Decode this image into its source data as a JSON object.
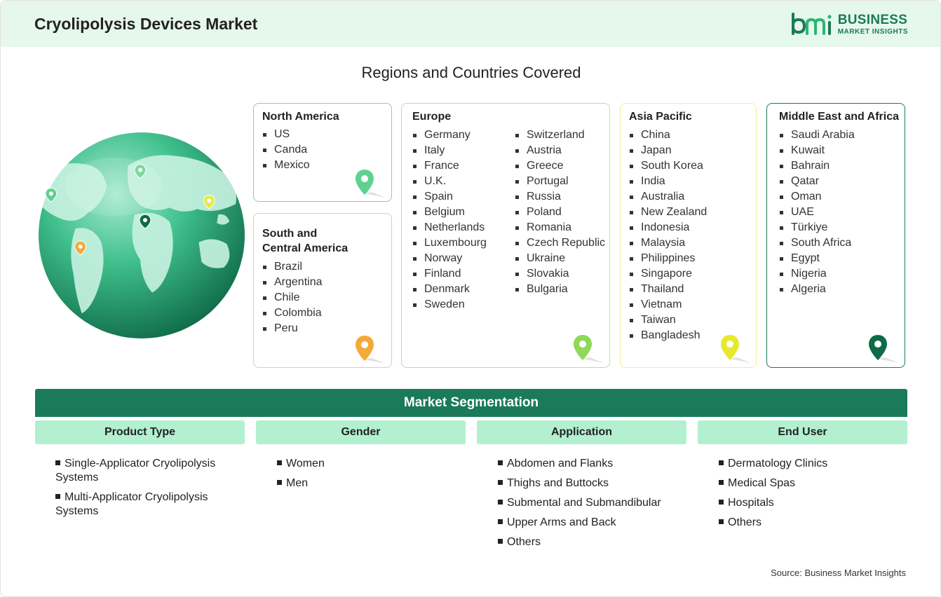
{
  "header": {
    "title": "Cryolipolysis Devices Market",
    "logo_line1": "BUSINESS",
    "logo_line2": "MARKET INSIGHTS",
    "brand_color": "#1a7a5a",
    "background": "#e6f7ec"
  },
  "regions": {
    "title": "Regions and Countries Covered",
    "north_america": {
      "title": "North America",
      "color": "#7ed8a0",
      "items": [
        "US",
        "Canda",
        "Mexico"
      ]
    },
    "south_central_america": {
      "title_line1": "South and",
      "title_line2": "Central America",
      "color": "#f5c98a",
      "items": [
        "Brazil",
        "Argentina",
        "Chile",
        "Colombia",
        "Peru"
      ]
    },
    "europe": {
      "title": "Europe",
      "color": "#b5e3a0",
      "col1": [
        "Germany",
        "Italy",
        "France",
        "U.K.",
        "Spain",
        "Belgium",
        "Netherlands",
        "Luxembourg",
        "Norway",
        "Finland",
        "Denmark",
        "Sweden"
      ],
      "col2": [
        "Switzerland",
        "Austria",
        "Greece",
        "Portugal",
        "Russia",
        "Poland",
        "Romania",
        "Czech Republic",
        "Ukraine",
        "Slovakia",
        "Bulgaria"
      ]
    },
    "asia_pacific": {
      "title": "Asia Pacific",
      "color": "#eef08a",
      "items": [
        "China",
        "Japan",
        "South Korea",
        "India",
        "Australia",
        "New Zealand",
        "Indonesia",
        "Malaysia",
        "Philippines",
        "Singapore",
        "Thailand",
        "Vietnam",
        "Taiwan",
        "Bangladesh"
      ]
    },
    "middle_east_africa": {
      "title": "Middle East and Africa",
      "color": "#1a7a5a",
      "items": [
        "Saudi Arabia",
        "Kuwait",
        "Bahrain",
        "Qatar",
        "Oman",
        "UAE",
        "Türkiye",
        "South Africa",
        "Egypt",
        "Nigeria",
        "Algeria"
      ]
    }
  },
  "segmentation": {
    "title": "Market Segmentation",
    "columns": [
      {
        "header": "Product Type",
        "items": [
          "Single-Applicator Cryolipolysis Systems",
          "Multi-Applicator Cryolipolysis Systems"
        ]
      },
      {
        "header": "Gender",
        "items": [
          "Women",
          "Men"
        ]
      },
      {
        "header": "Application",
        "items": [
          "Abdomen and Flanks",
          "Thighs and Buttocks",
          "Submental and Submandibular",
          "Upper Arms and Back",
          "Others"
        ]
      },
      {
        "header": "End User",
        "items": [
          "Dermatology Clinics",
          "Medical Spas",
          "Hospitals",
          "Others"
        ]
      }
    ]
  },
  "source": "Source: Business Market Insights"
}
